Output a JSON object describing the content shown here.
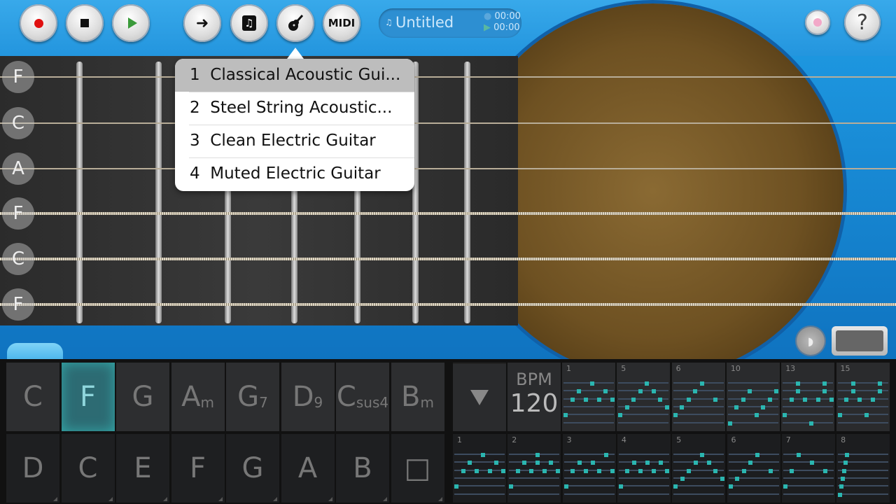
{
  "toolbar": {
    "buttons": [
      {
        "name": "record-button",
        "icon": "record-icon"
      },
      {
        "name": "stop-button",
        "icon": "stop-icon"
      },
      {
        "name": "play-button",
        "icon": "play-icon"
      },
      {
        "name": "next-button",
        "icon": "arrow-right-icon"
      },
      {
        "name": "songs-button",
        "icon": "music-note-icon"
      },
      {
        "name": "instrument-button",
        "icon": "guitar-icon"
      },
      {
        "name": "midi-button",
        "label": "MIDI"
      }
    ],
    "song": {
      "title": "Untitled",
      "time_elapsed": "00:00",
      "time_total": "00:00"
    },
    "help_label": "?"
  },
  "colors": {
    "accent": "#2bb6b0",
    "body": "#1a8fd8",
    "record": "#e01010"
  },
  "strings": [
    "F",
    "C",
    "A",
    "F",
    "C",
    "F"
  ],
  "instrument_menu": {
    "selected": 0,
    "items": [
      {
        "num": "1",
        "label": "Classical Acoustic Gui..."
      },
      {
        "num": "2",
        "label": "Steel String Acoustic..."
      },
      {
        "num": "3",
        "label": "Clean Electric Guitar"
      },
      {
        "num": "4",
        "label": "Muted Electric Guitar"
      }
    ]
  },
  "chords": {
    "active": 1,
    "row1": [
      [
        "C",
        ""
      ],
      [
        "F",
        ""
      ],
      [
        "G",
        ""
      ],
      [
        "A",
        "m"
      ],
      [
        "G",
        "7"
      ],
      [
        "D",
        "9"
      ],
      [
        "C",
        "sus4"
      ],
      [
        "B",
        "m"
      ]
    ],
    "row2": [
      "D",
      "C",
      "E",
      "F",
      "G",
      "A",
      "B",
      "□"
    ]
  },
  "tempo": {
    "label": "BPM",
    "value": "120"
  },
  "patterns": {
    "row1": [
      {
        "num": "1",
        "dots": [
          [
            0,
            4
          ],
          [
            1,
            2
          ],
          [
            1,
            6
          ],
          [
            2,
            1
          ],
          [
            2,
            3
          ],
          [
            2,
            5
          ],
          [
            2,
            7
          ],
          [
            4,
            0
          ]
        ]
      },
      {
        "num": "5",
        "dots": [
          [
            0,
            4
          ],
          [
            1,
            3
          ],
          [
            1,
            5
          ],
          [
            2,
            2
          ],
          [
            2,
            6
          ],
          [
            3,
            1
          ],
          [
            3,
            7
          ],
          [
            4,
            0
          ]
        ]
      },
      {
        "num": "6",
        "dots": [
          [
            0,
            4
          ],
          [
            1,
            3
          ],
          [
            2,
            2
          ],
          [
            2,
            6
          ],
          [
            3,
            1
          ],
          [
            4,
            0
          ]
        ]
      },
      {
        "num": "10",
        "dots": [
          [
            1,
            3
          ],
          [
            1,
            7
          ],
          [
            2,
            2
          ],
          [
            2,
            6
          ],
          [
            3,
            1
          ],
          [
            3,
            5
          ],
          [
            4,
            4
          ],
          [
            5,
            0
          ]
        ]
      },
      {
        "num": "13",
        "dots": [
          [
            0,
            2
          ],
          [
            0,
            6
          ],
          [
            1,
            2
          ],
          [
            1,
            6
          ],
          [
            2,
            1
          ],
          [
            2,
            3
          ],
          [
            2,
            5
          ],
          [
            2,
            7
          ],
          [
            4,
            0
          ],
          [
            5,
            4
          ]
        ]
      },
      {
        "num": "15",
        "dots": [
          [
            0,
            2
          ],
          [
            0,
            6
          ],
          [
            1,
            2
          ],
          [
            1,
            6
          ],
          [
            2,
            1
          ],
          [
            2,
            3
          ],
          [
            2,
            5
          ],
          [
            4,
            0
          ],
          [
            4,
            4
          ]
        ]
      }
    ],
    "row2": [
      {
        "num": "1",
        "dots": [
          [
            0,
            4
          ],
          [
            1,
            2
          ],
          [
            1,
            6
          ],
          [
            2,
            1
          ],
          [
            2,
            3
          ],
          [
            2,
            5
          ],
          [
            2,
            7
          ],
          [
            4,
            0
          ]
        ]
      },
      {
        "num": "2",
        "dots": [
          [
            0,
            4
          ],
          [
            1,
            2
          ],
          [
            1,
            4
          ],
          [
            1,
            6
          ],
          [
            2,
            1
          ],
          [
            2,
            3
          ],
          [
            2,
            5
          ],
          [
            2,
            7
          ],
          [
            4,
            0
          ]
        ]
      },
      {
        "num": "3",
        "dots": [
          [
            0,
            6
          ],
          [
            1,
            2
          ],
          [
            1,
            4
          ],
          [
            2,
            1
          ],
          [
            2,
            3
          ],
          [
            2,
            5
          ],
          [
            2,
            7
          ],
          [
            4,
            0
          ]
        ]
      },
      {
        "num": "4",
        "dots": [
          [
            1,
            2
          ],
          [
            1,
            4
          ],
          [
            1,
            6
          ],
          [
            2,
            1
          ],
          [
            2,
            3
          ],
          [
            2,
            5
          ],
          [
            2,
            7
          ],
          [
            4,
            0
          ]
        ]
      },
      {
        "num": "5",
        "dots": [
          [
            0,
            4
          ],
          [
            1,
            3
          ],
          [
            1,
            5
          ],
          [
            2,
            2
          ],
          [
            2,
            6
          ],
          [
            3,
            1
          ],
          [
            3,
            7
          ],
          [
            4,
            0
          ]
        ]
      },
      {
        "num": "6",
        "dots": [
          [
            0,
            4
          ],
          [
            1,
            3
          ],
          [
            2,
            2
          ],
          [
            2,
            6
          ],
          [
            3,
            1
          ],
          [
            4,
            0
          ]
        ]
      },
      {
        "num": "7",
        "dots": [
          [
            0,
            2
          ],
          [
            1,
            4
          ],
          [
            2,
            1
          ],
          [
            2,
            6
          ],
          [
            4,
            0
          ]
        ]
      },
      {
        "num": "8",
        "dots": [
          [
            0,
            1
          ],
          [
            1,
            0.8
          ],
          [
            2,
            0.6
          ],
          [
            3,
            0.4
          ],
          [
            4,
            0.2
          ],
          [
            5,
            0
          ]
        ]
      }
    ]
  }
}
